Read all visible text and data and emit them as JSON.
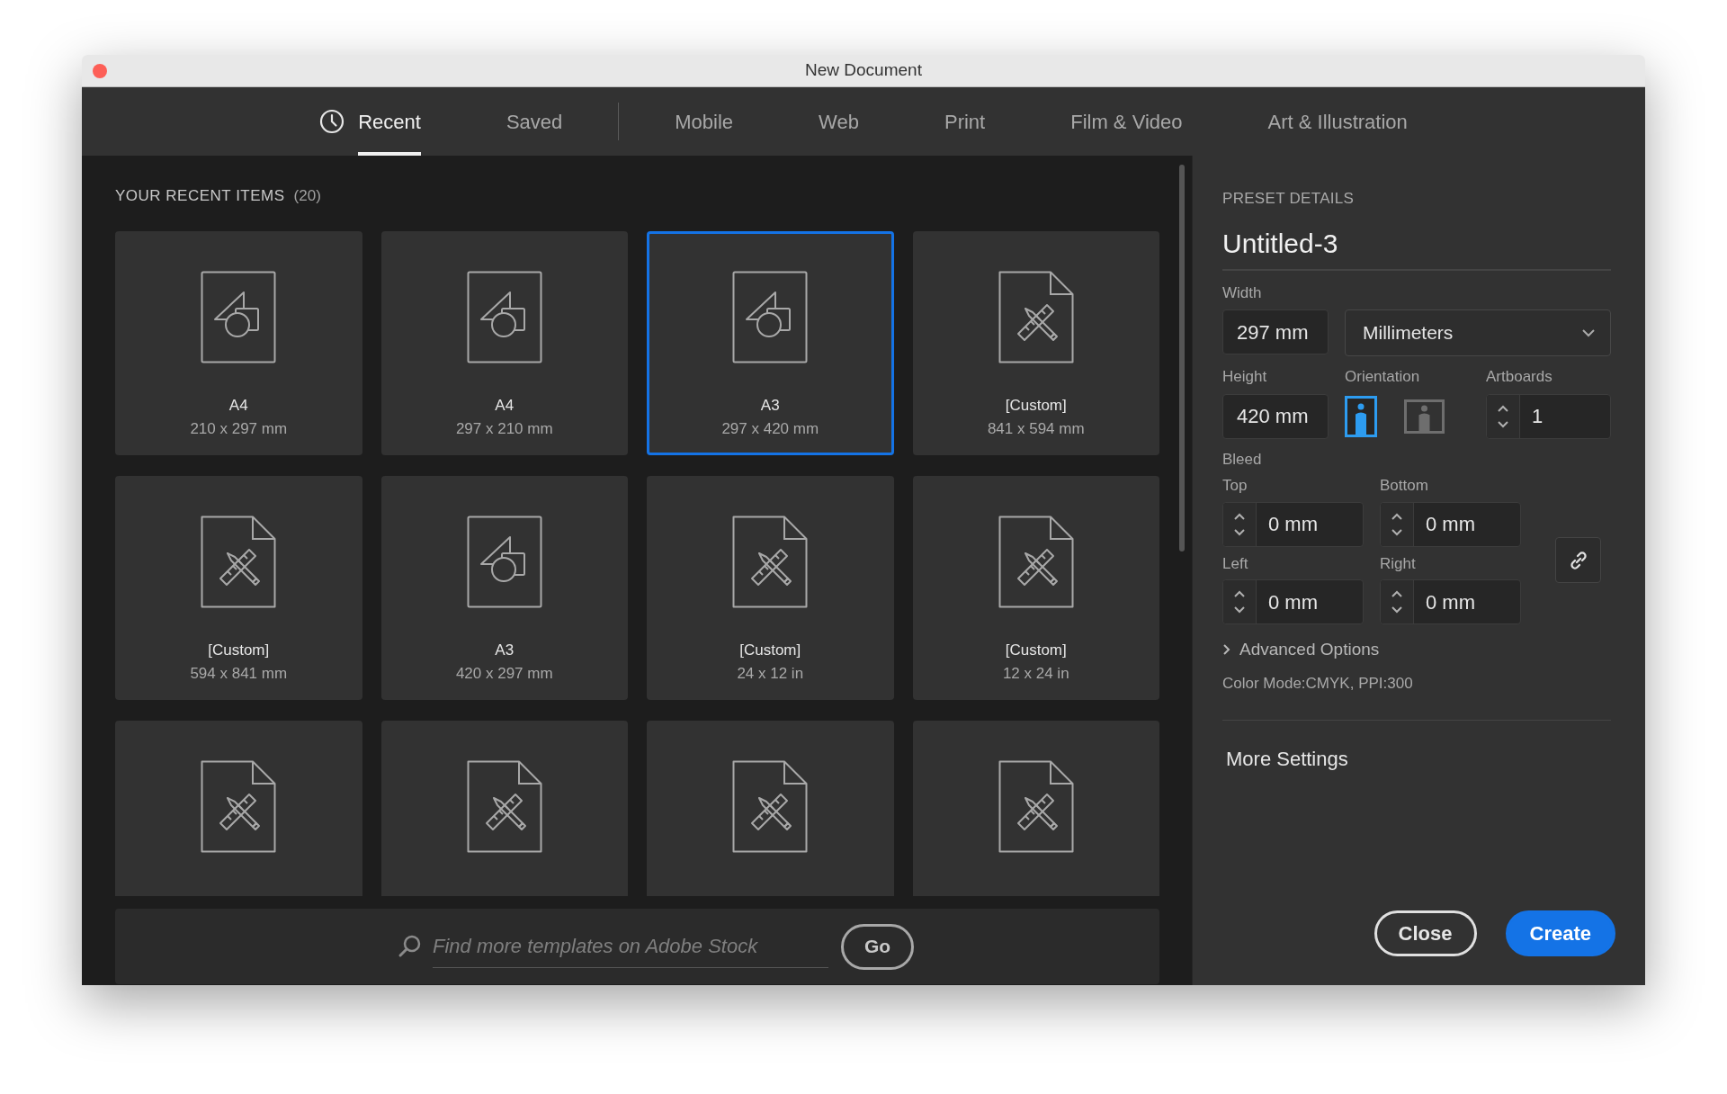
{
  "window": {
    "title": "New Document"
  },
  "tabs": [
    {
      "label": "Recent",
      "selected": true,
      "kind": "history"
    },
    {
      "label": "Saved",
      "selected": false,
      "kind": "library"
    },
    {
      "label": "Mobile",
      "selected": false,
      "kind": "category"
    },
    {
      "label": "Web",
      "selected": false,
      "kind": "category"
    },
    {
      "label": "Print",
      "selected": false,
      "kind": "category"
    },
    {
      "label": "Film & Video",
      "selected": false,
      "kind": "category"
    },
    {
      "label": "Art & Illustration",
      "selected": false,
      "kind": "category"
    }
  ],
  "recent": {
    "heading": "YOUR RECENT ITEMS",
    "count": "(20)",
    "items": [
      {
        "kind": "shapes",
        "name": "A4",
        "size": "210 x 297 mm",
        "selected": false
      },
      {
        "kind": "shapes",
        "name": "A4",
        "size": "297 x 210 mm",
        "selected": false
      },
      {
        "kind": "shapes",
        "name": "A3",
        "size": "297 x 420 mm",
        "selected": true
      },
      {
        "kind": "tools",
        "name": "[Custom]",
        "size": "841 x 594 mm",
        "selected": false
      },
      {
        "kind": "tools",
        "name": "[Custom]",
        "size": "594 x 841 mm",
        "selected": false
      },
      {
        "kind": "shapes",
        "name": "A3",
        "size": "420 x 297 mm",
        "selected": false
      },
      {
        "kind": "tools",
        "name": "[Custom]",
        "size": "24 x 12 in",
        "selected": false
      },
      {
        "kind": "tools",
        "name": "[Custom]",
        "size": "12 x 24 in",
        "selected": false
      },
      {
        "kind": "tools",
        "selected": false
      },
      {
        "kind": "tools",
        "selected": false
      },
      {
        "kind": "tools",
        "selected": false
      },
      {
        "kind": "tools",
        "selected": false
      }
    ]
  },
  "search": {
    "placeholder": "Find more templates on Adobe Stock",
    "button": "Go"
  },
  "preset": {
    "heading": "PRESET DETAILS",
    "name": "Untitled-3",
    "width_label": "Width",
    "width": "297 mm",
    "units": "Millimeters",
    "height_label": "Height",
    "height": "420 mm",
    "orientation_label": "Orientation",
    "orientation": [
      {
        "kind": "portrait",
        "selected": true
      },
      {
        "kind": "landscape",
        "selected": false
      }
    ],
    "artboards_label": "Artboards",
    "artboards": "1",
    "bleed_label": "Bleed",
    "bleed": [
      {
        "label": "Top",
        "value": "0 mm"
      },
      {
        "label": "Bottom",
        "value": "0 mm"
      },
      {
        "label": "Left",
        "value": "0 mm"
      },
      {
        "label": "Right",
        "value": "0 mm"
      }
    ],
    "advanced": {
      "label": "Advanced Options",
      "expanded": false
    },
    "info": "Color Mode:CMYK, PPI:300",
    "more_settings": "More Settings"
  },
  "buttons": [
    {
      "label": "Close",
      "kind": "secondary"
    },
    {
      "label": "Create",
      "kind": "primary"
    }
  ]
}
